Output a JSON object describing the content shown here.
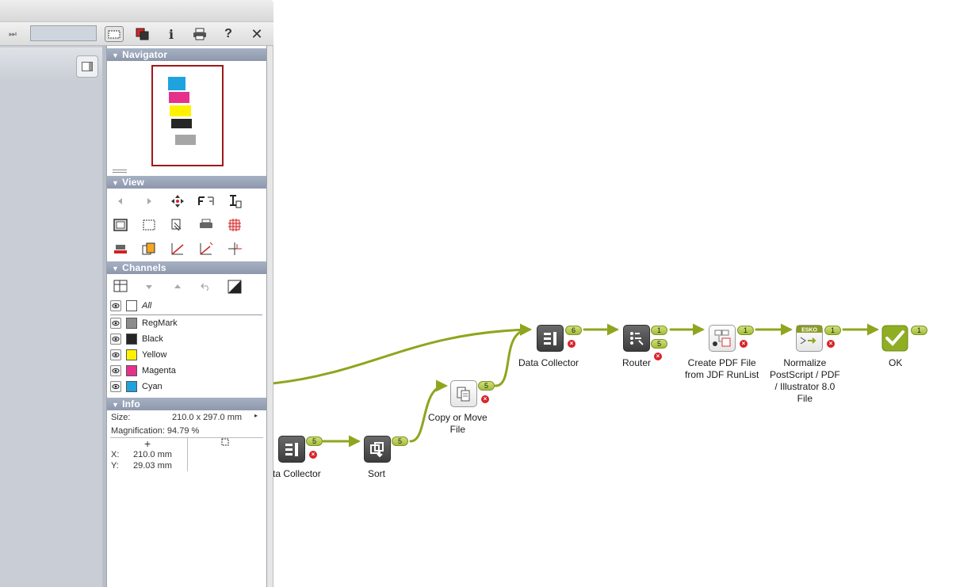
{
  "toolbar": {
    "items": [
      "skip-icon",
      "field",
      "select-frame-icon",
      "color-separation-icon",
      "info-icon",
      "print-icon",
      "help-icon",
      "close-icon"
    ],
    "help_label": "?",
    "info_label": "i",
    "close_label": "✕",
    "skip_label": "⏭"
  },
  "navigator": {
    "title": "Navigator",
    "swatch_colors": [
      "#1ea3de",
      "#e6318a",
      "#fff200",
      "#262626",
      "#a6a6a6"
    ]
  },
  "view": {
    "title": "View"
  },
  "channels": {
    "title": "Channels",
    "rows": [
      {
        "name": "All",
        "color": "#ffffff",
        "italic": true
      },
      {
        "name": "RegMark",
        "color": "#8c8c8c"
      },
      {
        "name": "Black",
        "color": "#262626"
      },
      {
        "name": "Yellow",
        "color": "#fff200"
      },
      {
        "name": "Magenta",
        "color": "#e6318a"
      },
      {
        "name": "Cyan",
        "color": "#1ea3de"
      }
    ]
  },
  "info": {
    "title": "Info",
    "size_label": "Size:",
    "size_value": "210.0 x 297.0 mm",
    "magnification": "Magnification: 94.79 %",
    "x_label": "X:",
    "x_value": "210.0 mm",
    "y_label": "Y:",
    "y_value": "29.03 mm"
  },
  "flow": {
    "nodes": [
      {
        "id": "data-collector-1",
        "label": "ta Collector",
        "icon": "data-collector-icon"
      },
      {
        "id": "sort",
        "label": "Sort",
        "icon": "sort-icon"
      },
      {
        "id": "copy-move",
        "label": "Copy or Move\nFile",
        "icon": "copy-file-icon"
      },
      {
        "id": "data-collector-2",
        "label": "Data Collector",
        "icon": "data-collector-icon"
      },
      {
        "id": "router",
        "label": "Router",
        "icon": "router-icon"
      },
      {
        "id": "create-pdf",
        "label": "Create PDF File\nfrom JDF RunList",
        "icon": "create-pdf-icon"
      },
      {
        "id": "normalize",
        "label": "Normalize\nPostScript / PDF\n/ Illustrator 8.0\nFile",
        "icon": "esko-normalize-icon",
        "badge": "ESKO"
      },
      {
        "id": "ok",
        "label": "OK",
        "icon": "checkmark-icon"
      }
    ],
    "counts": {
      "data_collector_1_out": "5",
      "sort_out": "5",
      "copy_move_out": "5",
      "data_collector_2_out": "6",
      "router_out_1": "1",
      "router_out_2": "5",
      "create_pdf_out": "1",
      "normalize_out": "1",
      "ok_out": "1"
    },
    "error_symbol": "×",
    "connector_color": "#8fa51e"
  }
}
